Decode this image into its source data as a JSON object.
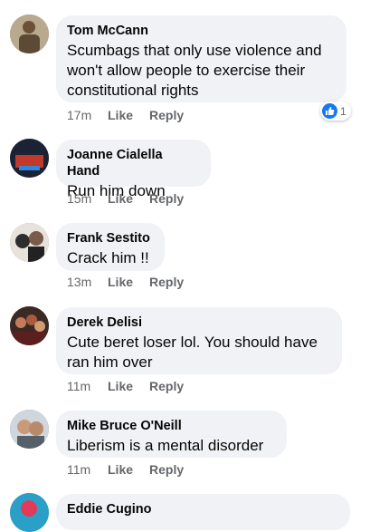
{
  "colors": {
    "bubble": "#f0f2f5",
    "meta": "#65676b",
    "like_blue": "#1877f2"
  },
  "comments": [
    {
      "author": "Tom McCann",
      "text": "Scumbags that only use violence and won't allow people to exercise their constitutional rights",
      "time": "17m",
      "like": "Like",
      "reply": "Reply",
      "reaction": {
        "icon": "thumbs-up-icon",
        "count": "1"
      }
    },
    {
      "author": "Joanne Cialella Hand",
      "text": "Run him down",
      "time": "15m",
      "like": "Like",
      "reply": "Reply"
    },
    {
      "author": "Frank Sestito",
      "text": "Crack him !!",
      "time": "13m",
      "like": "Like",
      "reply": "Reply"
    },
    {
      "author": "Derek Delisi",
      "text": "Cute beret loser lol. You should have ran him over",
      "time": "11m",
      "like": "Like",
      "reply": "Reply"
    },
    {
      "author": "Mike Bruce O'Neill",
      "text": "Liberism is a mental disorder",
      "time": "11m",
      "like": "Like",
      "reply": "Reply"
    },
    {
      "author": "Eddie Cugino",
      "text": ""
    }
  ]
}
